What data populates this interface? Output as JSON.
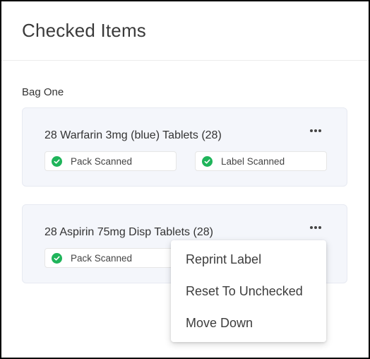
{
  "page": {
    "title": "Checked Items"
  },
  "bag": {
    "label": "Bag One",
    "items": [
      {
        "title": "28 Warfarin 3mg (blue) Tablets (28)",
        "badges": [
          "Pack Scanned",
          "Label Scanned"
        ]
      },
      {
        "title": "28 Aspirin 75mg Disp Tablets (28)",
        "badges": [
          "Pack Scanned"
        ]
      }
    ]
  },
  "menu": {
    "items": [
      "Reprint Label",
      "Reset To Unchecked",
      "Move Down"
    ]
  },
  "icons": {
    "badge": "check-circle-icon",
    "more": "more-horizontal-icon"
  },
  "colors": {
    "check": "#1fb45a",
    "card_bg": "#f4f6fb"
  }
}
